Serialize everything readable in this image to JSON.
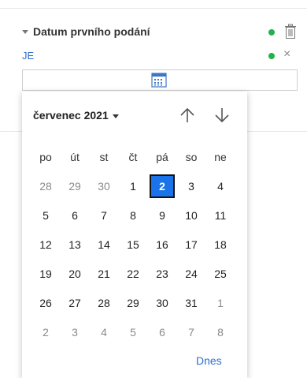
{
  "filter": {
    "title": "Datum prvního podání",
    "operator": "JE",
    "status_color": "#22b24c"
  },
  "calendar": {
    "month_label": "červenec 2021",
    "weekdays": [
      "po",
      "út",
      "st",
      "čt",
      "pá",
      "so",
      "ne"
    ],
    "weeks": [
      [
        {
          "d": "28",
          "m": "o"
        },
        {
          "d": "29",
          "m": "o"
        },
        {
          "d": "30",
          "m": "o"
        },
        {
          "d": "1",
          "m": "c"
        },
        {
          "d": "2",
          "m": "s"
        },
        {
          "d": "3",
          "m": "c"
        },
        {
          "d": "4",
          "m": "c"
        }
      ],
      [
        {
          "d": "5",
          "m": "c"
        },
        {
          "d": "6",
          "m": "c"
        },
        {
          "d": "7",
          "m": "c"
        },
        {
          "d": "8",
          "m": "c"
        },
        {
          "d": "9",
          "m": "c"
        },
        {
          "d": "10",
          "m": "c"
        },
        {
          "d": "11",
          "m": "c"
        }
      ],
      [
        {
          "d": "12",
          "m": "c"
        },
        {
          "d": "13",
          "m": "c"
        },
        {
          "d": "14",
          "m": "c"
        },
        {
          "d": "15",
          "m": "c"
        },
        {
          "d": "16",
          "m": "c"
        },
        {
          "d": "17",
          "m": "c"
        },
        {
          "d": "18",
          "m": "c"
        }
      ],
      [
        {
          "d": "19",
          "m": "c"
        },
        {
          "d": "20",
          "m": "c"
        },
        {
          "d": "21",
          "m": "c"
        },
        {
          "d": "22",
          "m": "c"
        },
        {
          "d": "23",
          "m": "c"
        },
        {
          "d": "24",
          "m": "c"
        },
        {
          "d": "25",
          "m": "c"
        }
      ],
      [
        {
          "d": "26",
          "m": "c"
        },
        {
          "d": "27",
          "m": "c"
        },
        {
          "d": "28",
          "m": "c"
        },
        {
          "d": "29",
          "m": "c"
        },
        {
          "d": "30",
          "m": "c"
        },
        {
          "d": "31",
          "m": "c"
        },
        {
          "d": "1",
          "m": "o"
        }
      ],
      [
        {
          "d": "2",
          "m": "o"
        },
        {
          "d": "3",
          "m": "o"
        },
        {
          "d": "4",
          "m": "o"
        },
        {
          "d": "5",
          "m": "o"
        },
        {
          "d": "6",
          "m": "o"
        },
        {
          "d": "7",
          "m": "o"
        },
        {
          "d": "8",
          "m": "o"
        }
      ]
    ],
    "today_label": "Dnes",
    "icons": {
      "prev": "arrow-up-icon",
      "next": "arrow-down-icon",
      "calendar": "calendar-icon",
      "delete": "trash-icon",
      "remove": "close-icon"
    }
  }
}
